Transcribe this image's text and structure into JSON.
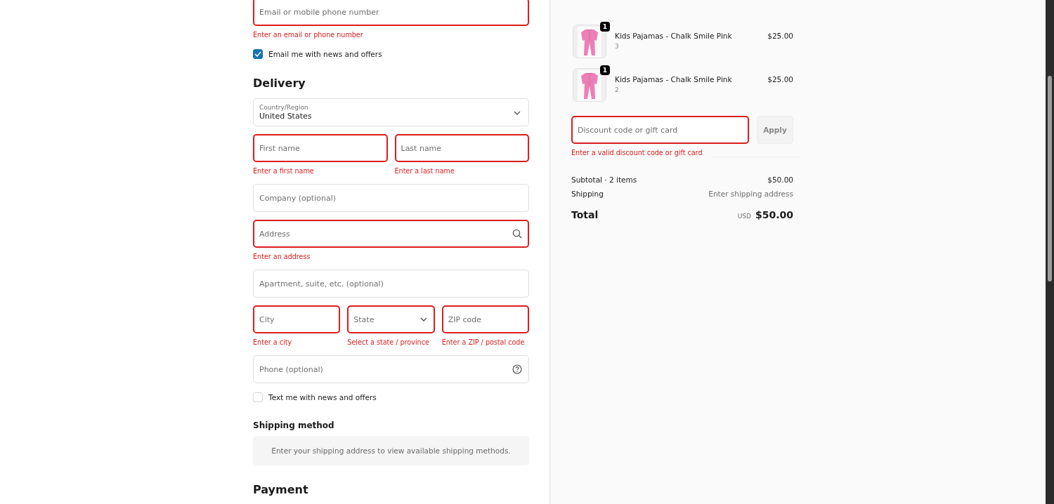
{
  "contact": {
    "field": {
      "placeholder": "Email or mobile phone number",
      "invalid": true,
      "error": "Enter an email or phone number"
    },
    "checkbox": {
      "label": "Email me with news and offers",
      "checked": true
    }
  },
  "delivery": {
    "heading": "Delivery",
    "fields": [
      {
        "kind": "select",
        "label": "Country/Region",
        "value": "United States",
        "invalid": false
      },
      {
        "kind": "row",
        "items": [
          {
            "kind": "text",
            "placeholder": "First name",
            "invalid": true,
            "error": "Enter a first name"
          },
          {
            "kind": "text",
            "placeholder": "Last name",
            "invalid": true,
            "error": "Enter a last name"
          }
        ]
      },
      {
        "kind": "text",
        "placeholder": "Company (optional)",
        "invalid": false
      },
      {
        "kind": "address",
        "placeholder": "Address",
        "invalid": true,
        "error": "Enter an address"
      },
      {
        "kind": "text",
        "placeholder": "Apartment, suite, etc. (optional)",
        "invalid": false
      },
      {
        "kind": "row",
        "items": [
          {
            "kind": "text",
            "placeholder": "City",
            "invalid": true,
            "error": "Enter a city"
          },
          {
            "kind": "dropdown",
            "placeholder": "State",
            "invalid": true,
            "error": "Select a state / province"
          },
          {
            "kind": "text",
            "placeholder": "ZIP code",
            "invalid": true,
            "error": "Enter a ZIP / postal code"
          }
        ]
      },
      {
        "kind": "phone",
        "placeholder": "Phone (optional)",
        "invalid": false
      }
    ],
    "checkbox": {
      "label": "Text me with news and offers",
      "checked": false
    }
  },
  "shipping_method": {
    "heading": "Shipping method",
    "notice": "Enter your shipping address to view available shipping methods."
  },
  "payment": {
    "heading": "Payment"
  },
  "summary": {
    "items": [
      {
        "kind": "picture",
        "quantity": "1",
        "name": "Kids Pajamas - Chalk Smile Pink",
        "variant": "3",
        "price": "$25.00"
      },
      {
        "kind": "picture",
        "quantity": "1",
        "name": "Kids Pajamas - Chalk Smile Pink",
        "variant": "2",
        "price": "$25.00"
      }
    ],
    "discount": {
      "placeholder": "Discount code or gift card",
      "invalid": true,
      "error": "Enter a valid discount code or gift card",
      "button": "Apply"
    },
    "lines": [
      {
        "label": "Subtotal · 2 items",
        "value": "$50.00",
        "muted": false
      },
      {
        "label": "Shipping",
        "value": "Enter shipping address",
        "muted": true
      }
    ],
    "total": {
      "label": "Total",
      "currency": "USD",
      "value": "$50.00"
    }
  }
}
